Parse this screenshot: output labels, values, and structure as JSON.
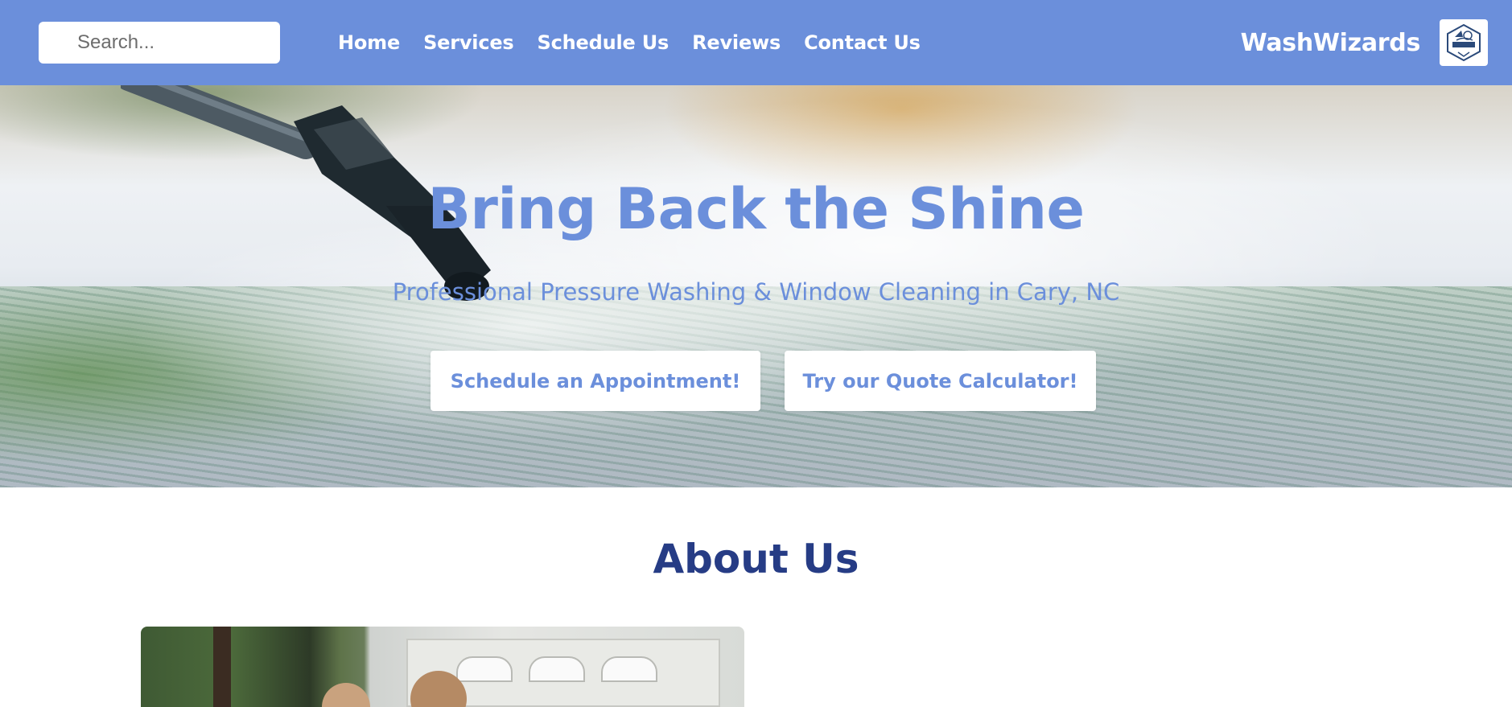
{
  "header": {
    "search_placeholder": "Search...",
    "nav": [
      {
        "label": "Home"
      },
      {
        "label": "Services"
      },
      {
        "label": "Schedule Us"
      },
      {
        "label": "Reviews"
      },
      {
        "label": "Contact Us"
      }
    ],
    "brand": "WashWizards",
    "logo_text": "WASH WIZARDS",
    "color": "#6b8fdb"
  },
  "hero": {
    "title": "Bring Back the Shine",
    "subtitle": "Professional Pressure Washing & Window Cleaning in Cary, NC",
    "buttons": {
      "schedule": "Schedule an Appointment!",
      "quote": "Try our Quote Calculator!"
    },
    "background_image": "pressure-washer-spraying-driveway"
  },
  "about": {
    "title": "About Us",
    "title_color": "#263c85",
    "photo": "team-in-front-of-garage"
  }
}
